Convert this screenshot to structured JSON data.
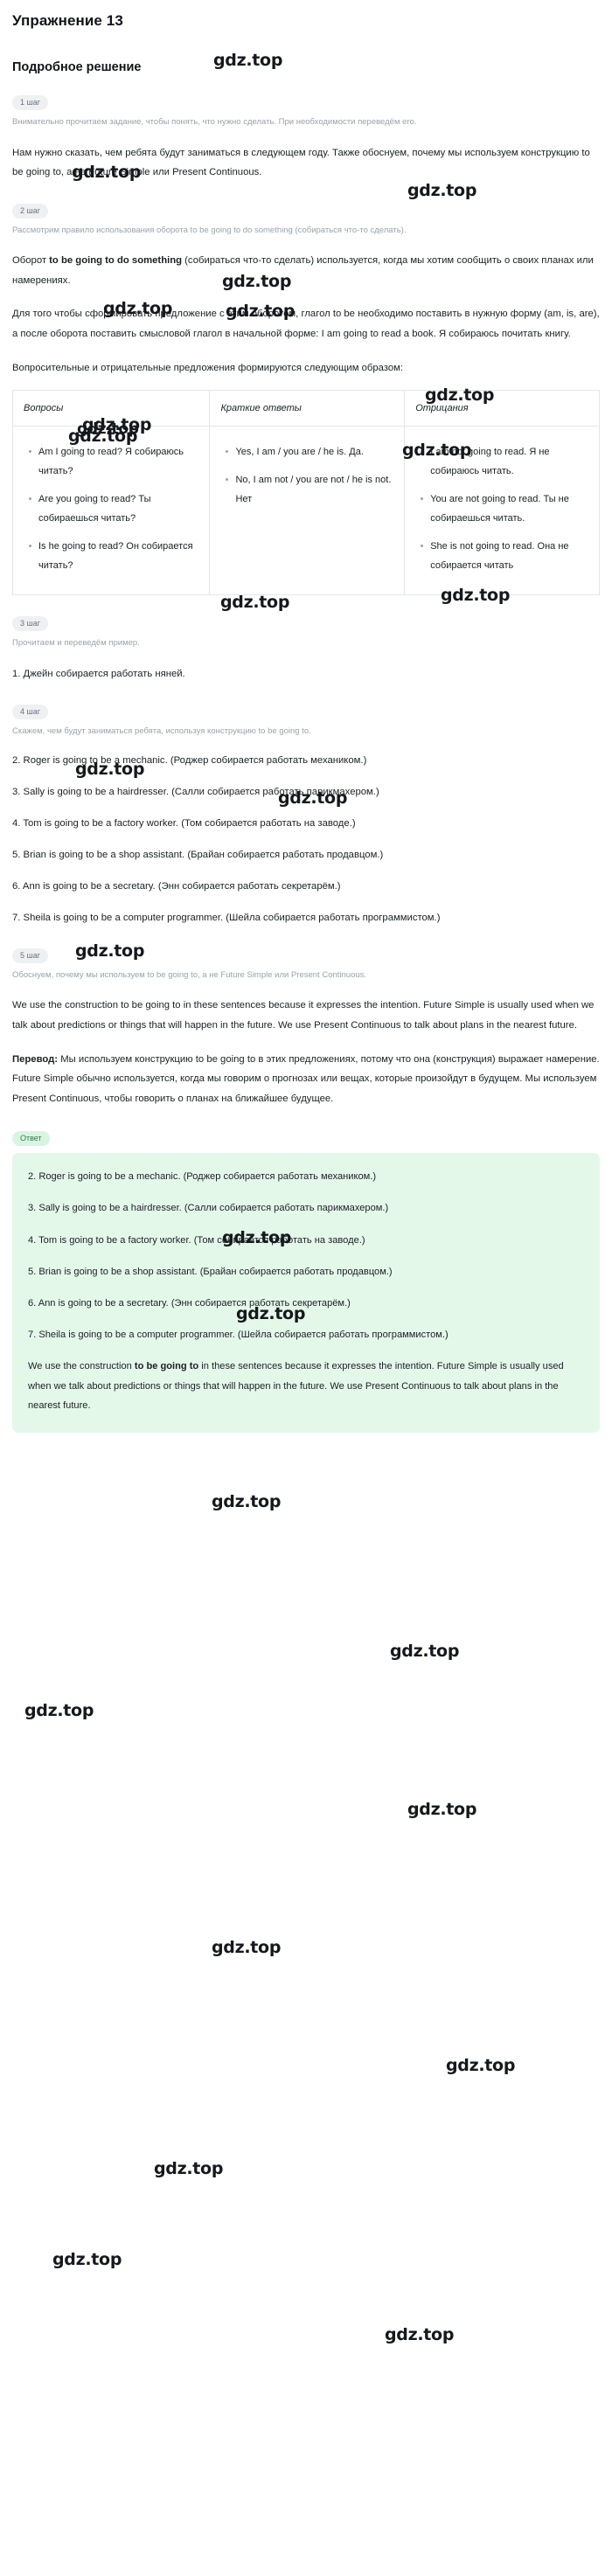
{
  "page": {
    "exercise_title": "Упражнение 13",
    "section_title": "Подробное решение",
    "watermark_text": "gdz.top"
  },
  "steps": {
    "step1": {
      "pill": "1 шаг",
      "hint": "Внимательно прочитаем задание, чтобы понять, что нужно сделать. При необходимости переведём его.",
      "body": "Нам нужно сказать, чем ребята будут заниматься в следующем году. Также обоснуем, почему мы используем конструкцию to be going to, а не Future Simple или Present Continuous."
    },
    "step2": {
      "pill": "2 шаг",
      "hint": "Рассмотрим правило использования оборота to be going to do something (собираться что-то сделать).",
      "para1_pre": "Оборот ",
      "para1_bold": "to be going to do something",
      "para1_post": " (собираться что-то сделать) используется, когда мы хотим сообщить о своих планах или намерениях.",
      "para2": "Для того чтобы сформировать предложение с этим оборотом, глагол to be необходимо поставить в нужную форму (am, is, are), а после оборота поставить смысловой глагол в начальной форме: I am going to read a book. Я собираюсь почитать книгу.",
      "para3": "Вопросительные и отрицательные предложения формируются следующим образом:",
      "table": {
        "headers": [
          "Вопросы",
          "Краткие ответы",
          "Отрицания"
        ],
        "columns": [
          [
            "Am I going to read? Я собираюсь читать?",
            "Are you going to read? Ты собираешься читать?",
            "Is he going to read? Он собирается читать?"
          ],
          [
            "Yes, I am / you are / he is. Да.",
            "No, I am not / you are not / he is not. Нет"
          ],
          [
            "I am not going to read. Я не собираюсь читать.",
            "You are not going to read. Ты не собираешься читать.",
            "She is not going to read. Она не собирается читать"
          ]
        ]
      }
    },
    "step3": {
      "pill": "3 шаг",
      "hint": "Прочитаем и переведём пример.",
      "item1": "1. Джейн собирается работать няней."
    },
    "step4": {
      "pill": "4 шаг",
      "hint": "Скажем, чем будут заниматься ребята, используя конструкцию to be going to.",
      "items": [
        "2. Roger is going to be a mechanic. (Роджер собирается работать механиком.)",
        "3. Sally is going to be a hairdresser. (Салли собирается работать парикмахером.)",
        "4. Tom is going to be a factory worker. (Том собирается работать на заводе.)",
        "5. Brian is going to be a shop assistant. (Брайан собирается работать продавцом.)",
        "6. Ann is going to be a secretary. (Энн собирается работать секретарём.)",
        "7. Sheila is going to be a computer programmer. (Шейла собирается работать программистом.)"
      ]
    },
    "step5": {
      "pill": "5 шаг",
      "hint": "Обоснуем, почему мы используем to be going to, а не Future Simple или Present Continuous.",
      "para_en": "We use the construction to be going to in these sentences because it expresses the intention. Future Simple is usually used when we talk about predictions or things that will happen in the future. We use Present Continuous to talk about plans in the nearest future.",
      "translation_label": "Перевод:",
      "translation_text": " Мы используем конструкцию to be going to в этих предложениях, потому что она (конструкция) выражает намерение. Future Simple обычно используется, когда мы говорим о прогнозах или вещах, которые произойдут в будущем. Мы используем Present Continuous, чтобы говорить о планах на ближайшее будущее."
    }
  },
  "answer": {
    "pill": "Ответ",
    "items": [
      "2. Roger is going to be a mechanic. (Роджер собирается работать механиком.)",
      "3. Sally is going to be a hairdresser. (Салли собирается работать парикмахером.)",
      "4. Tom is going to be a factory worker. (Том собирается работать на заводе.)",
      "5. Brian is going to be a shop assistant. (Брайан собирается работать продавцом.)",
      "6. Ann is going to be a secretary. (Энн собирается работать секретарём.)",
      "7. Sheila is going to be a computer programmer. (Шейла собирается работать программистом.)"
    ],
    "final_pre": "We use the construction ",
    "final_bold": "to be going to",
    "final_post": " in these sentences because it expresses the intention. Future Simple is usually used when we talk about predictions or things that will happen in the future. We use Present Continuous to talk about plans in the nearest future."
  },
  "colors": {
    "answer_bg": "#e4f8ea",
    "answer_pill_text": "#2f7a4d",
    "step_pill_bg": "#eef0f2",
    "hint_text": "#9aa2ab"
  }
}
